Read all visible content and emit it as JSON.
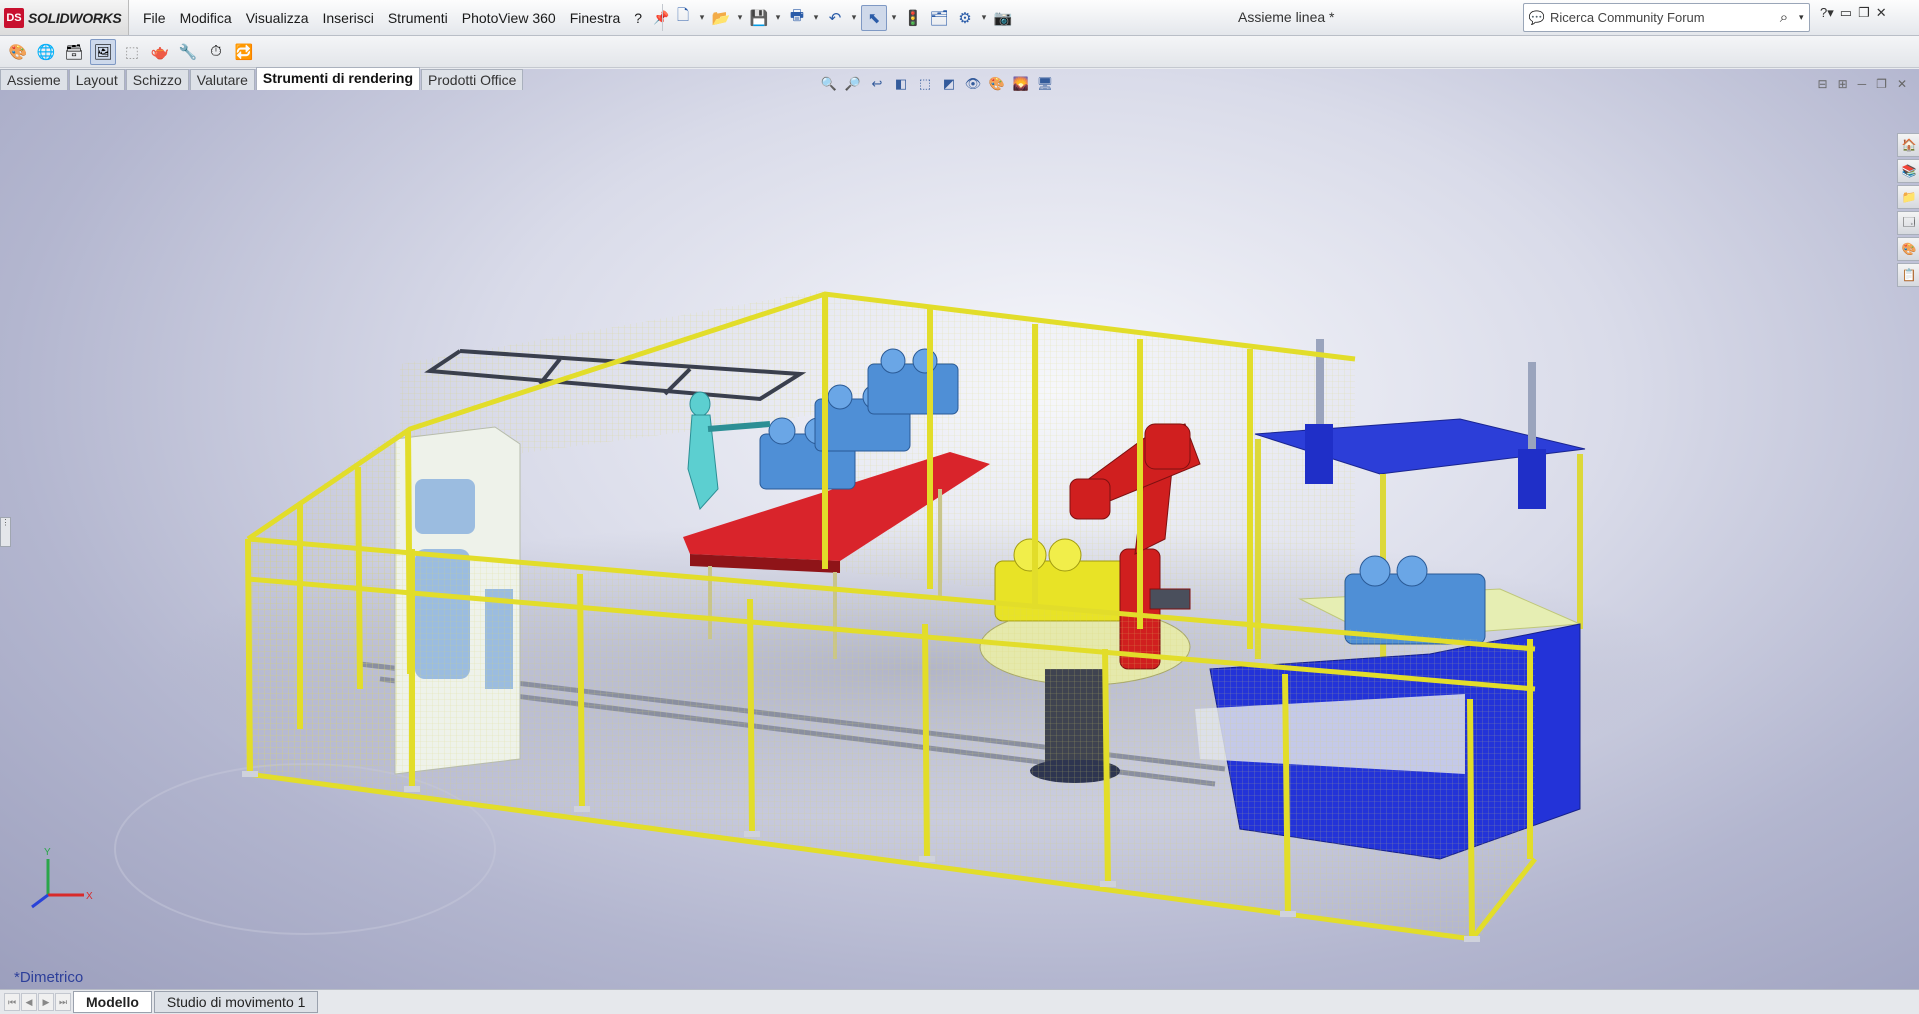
{
  "app": {
    "logo_mark": "DS",
    "logo_text": "SOLIDWORKS",
    "document_title": "Assieme linea *"
  },
  "menu": [
    "File",
    "Modifica",
    "Visualizza",
    "Inserisci",
    "Strumenti",
    "PhotoView 360",
    "Finestra",
    "?"
  ],
  "quick_access": [
    "new-icon",
    "open-icon",
    "save-icon",
    "print-icon",
    "undo-icon",
    "select-icon",
    "rebuild-icon",
    "file-properties-icon",
    "options-icon",
    "camera-icon"
  ],
  "search": {
    "placeholder": "Ricerca Community Forum"
  },
  "render_toolbar": [
    "appearance-icon",
    "scene-icon",
    "decal-icon",
    "preview-window-icon",
    "render-region-icon",
    "final-render-icon",
    "options-icon",
    "schedule-icon",
    "recall-icon"
  ],
  "command_tabs": [
    "Assieme",
    "Layout",
    "Schizzo",
    "Valutare",
    "Strumenti di rendering",
    "Prodotti Office"
  ],
  "command_tabs_active": "Strumenti di rendering",
  "view_name": "*Dimetrico",
  "status_tabs": [
    "Modello",
    "Studio di movimento 1"
  ],
  "status_tabs_active": "Modello",
  "colors": {
    "fence": "#e2dd2a",
    "robot": "#d01f1f",
    "conveyor": "#d9242b",
    "parts": "#4f8fd6",
    "press_blue": "#2333d8"
  }
}
